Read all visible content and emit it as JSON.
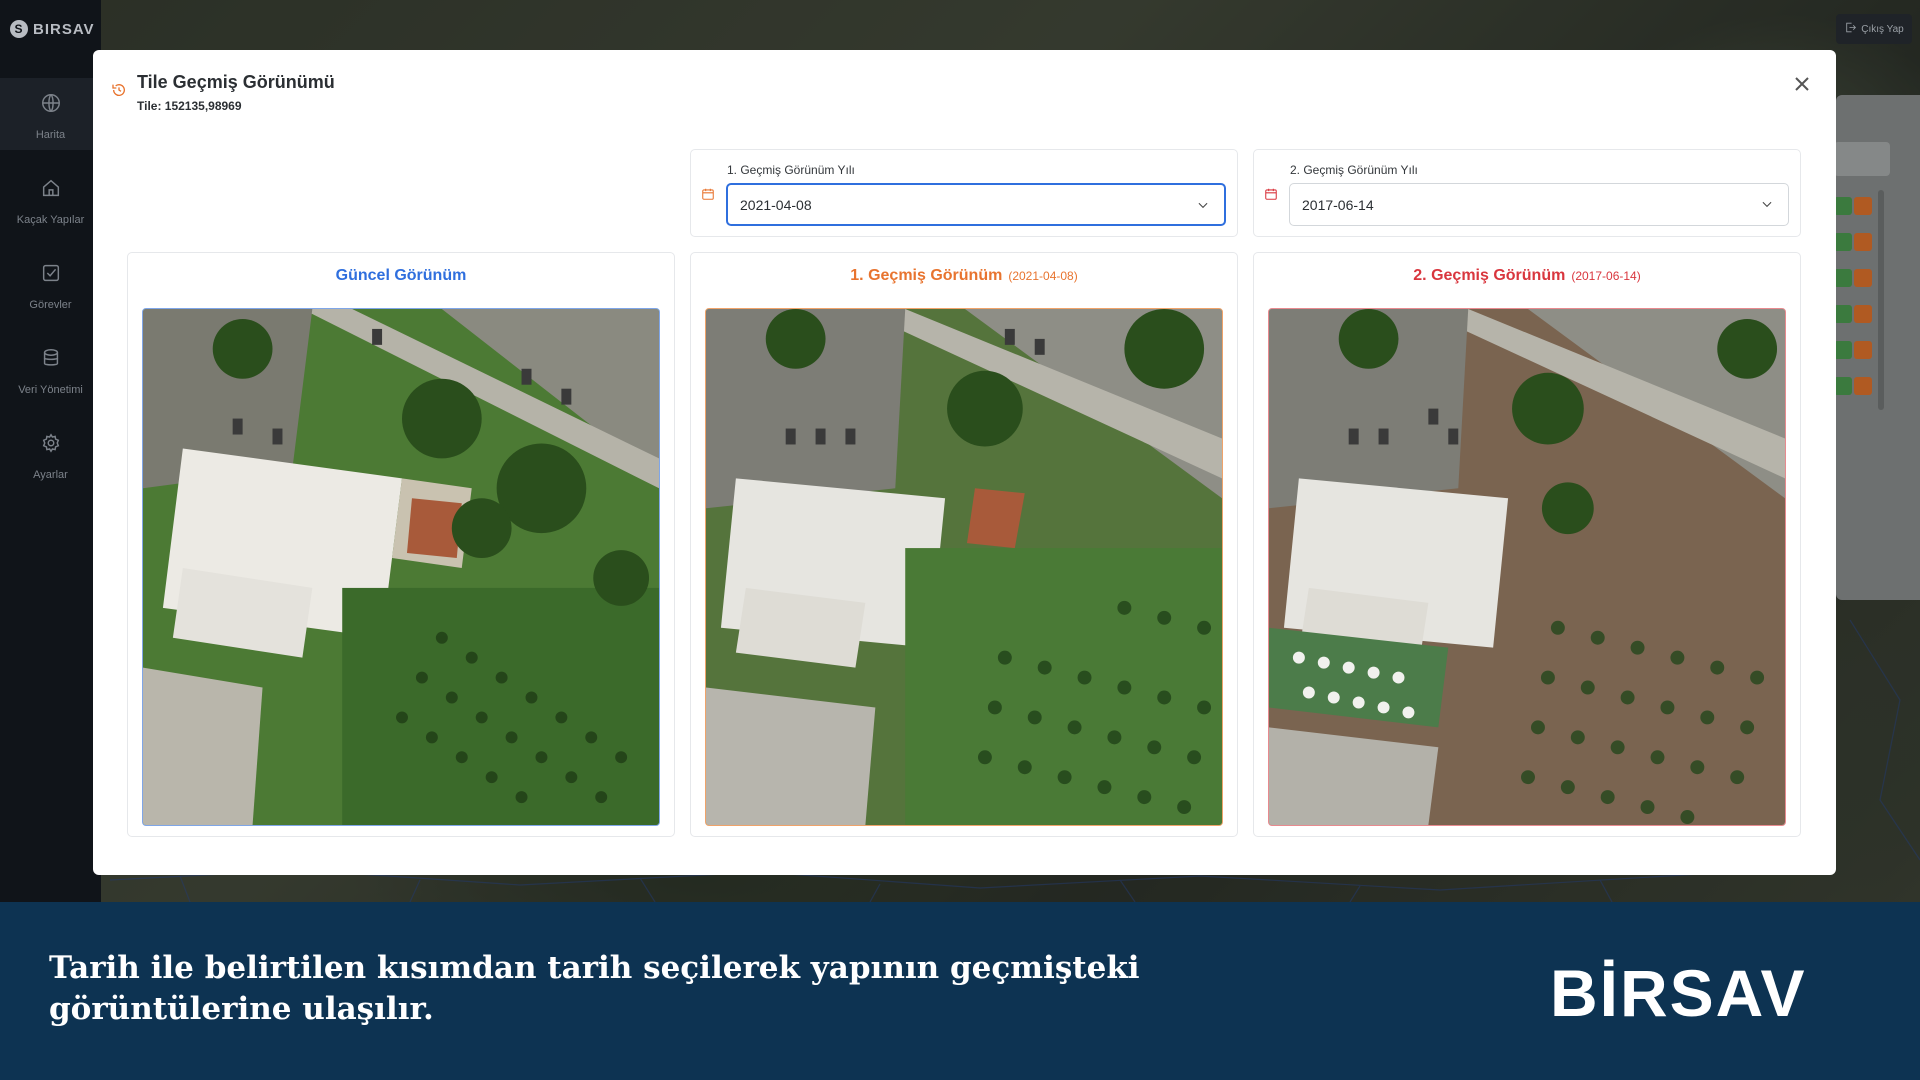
{
  "app": {
    "logo_text": "BIRSAV",
    "logout_label": "Çıkış Yap"
  },
  "sidebar": {
    "items": [
      {
        "label": "Harita",
        "icon": "globe-icon",
        "active": true
      },
      {
        "label": "Kaçak Yapılar",
        "icon": "home-icon",
        "active": false
      },
      {
        "label": "Görevler",
        "icon": "checkbox-icon",
        "active": false
      },
      {
        "label": "Veri Yönetimi",
        "icon": "database-icon",
        "active": false
      },
      {
        "label": "Ayarlar",
        "icon": "gear-icon",
        "active": false
      }
    ]
  },
  "modal": {
    "title": "Tile Geçmiş Görünümü",
    "subtitle": "Tile: 152135,98969",
    "picker1": {
      "label": "1. Geçmiş Görünüm Yılı",
      "value": "2021-04-08"
    },
    "picker2": {
      "label": "2. Geçmiş Görünüm Yılı",
      "value": "2017-06-14"
    },
    "views": [
      {
        "title": "Güncel Görünüm",
        "date": "",
        "color": "#2f6fde"
      },
      {
        "title": "1. Geçmiş Görünüm",
        "date": "(2021-04-08)",
        "color": "#e8742f"
      },
      {
        "title": "2. Geçmiş Görünüm",
        "date": "(2017-06-14)",
        "color": "#d9363e"
      }
    ]
  },
  "banner": {
    "text": "Tarih ile belirtilen kısımdan tarih seçilerek yapının geçmişteki görüntülerine ulaşılır.",
    "logo_text": "BİRSAV"
  }
}
